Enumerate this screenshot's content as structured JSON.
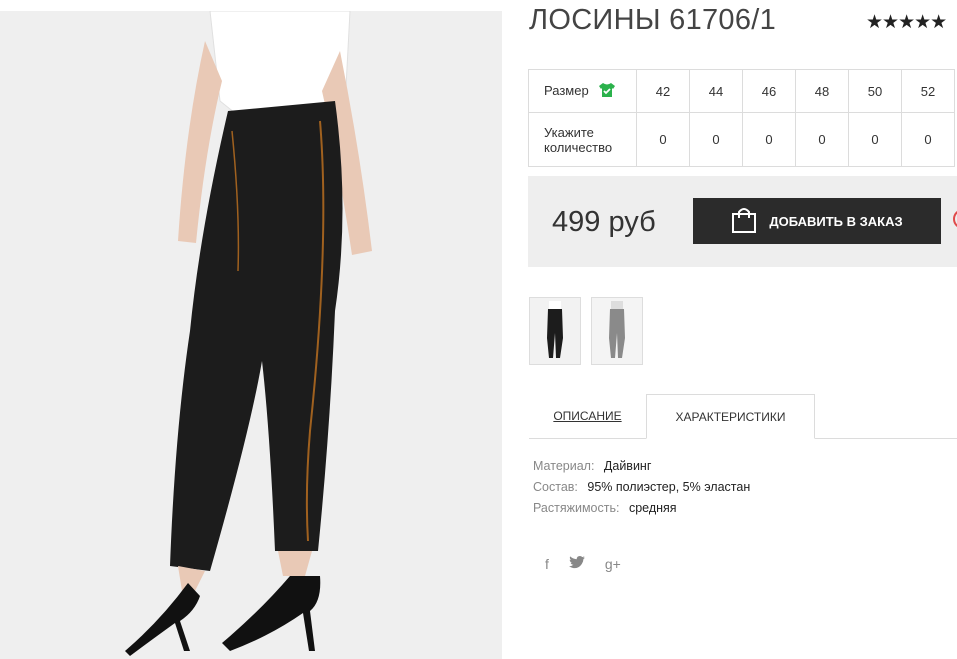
{
  "product": {
    "title": "ЛОСИНЫ 61706/1",
    "rating_stars": "★★★★★"
  },
  "sizes": {
    "size_label": "Размер",
    "qty_label": "Укажите количество",
    "values": [
      "42",
      "44",
      "46",
      "48",
      "50",
      "52"
    ],
    "quantities": [
      "0",
      "0",
      "0",
      "0",
      "0",
      "0"
    ]
  },
  "buy": {
    "price": "499 руб",
    "add_button_label": "ДОБАВИТЬ В ЗАКАЗ"
  },
  "tabs": {
    "description": "ОПИСАНИЕ",
    "characteristics": "ХАРАКТЕРИСТИКИ"
  },
  "properties": [
    {
      "key": "Материал:",
      "value": "Дайвинг"
    },
    {
      "key": "Состав:",
      "value": "95% полиэстер, 5% эластан"
    },
    {
      "key": "Растяжимость:",
      "value": "средняя"
    }
  ],
  "social": {
    "facebook": "f",
    "twitter": "🐦",
    "gplus": "g+"
  },
  "colors": {
    "accent_green": "#2bb24c",
    "button_dark": "#2b2b2b",
    "buybox_bg": "#eeeeee"
  }
}
